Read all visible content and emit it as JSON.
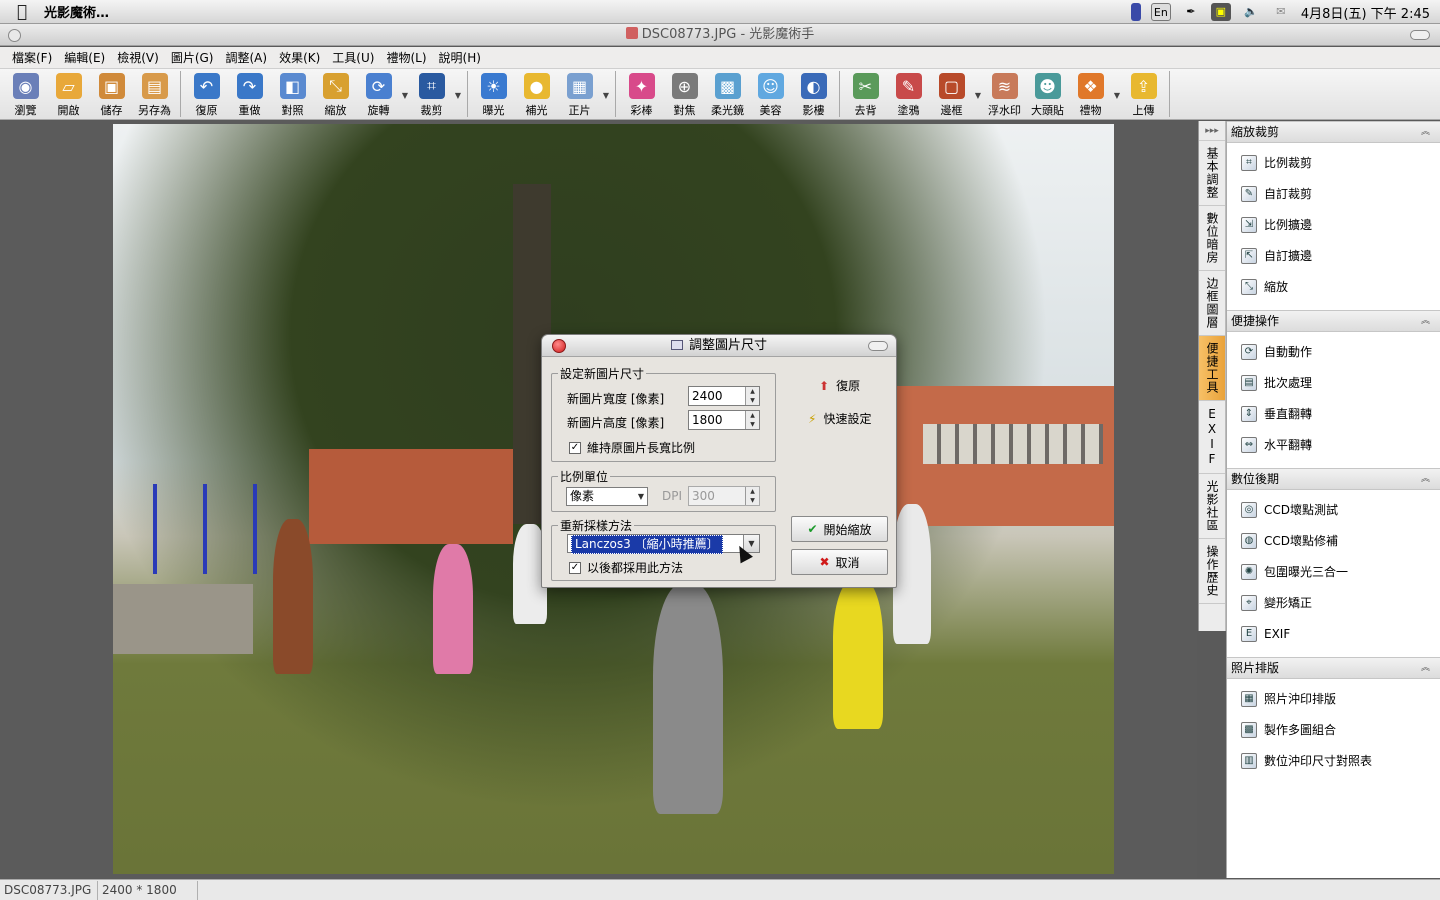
{
  "menubar": {
    "app_name": "光影魔術…",
    "input_lang": "En",
    "clock": "4月8日(五) 下午 2:45"
  },
  "window": {
    "title": "DSC08773.JPG - 光影魔術手"
  },
  "app_menu": [
    "檔案(F)",
    "編輯(E)",
    "檢視(V)",
    "圖片(G)",
    "調整(A)",
    "效果(K)",
    "工具(U)",
    "禮物(L)",
    "說明(H)"
  ],
  "toolbar": {
    "groups": [
      [
        {
          "label": "瀏覽",
          "icon": "eye-icon",
          "color": "#6a7fb8"
        },
        {
          "label": "開啟",
          "icon": "folder-open-icon",
          "color": "#e8a83a"
        },
        {
          "label": "儲存",
          "icon": "save-icon",
          "color": "#d08a3a"
        },
        {
          "label": "另存為",
          "icon": "save-as-icon",
          "color": "#d89a4a"
        }
      ],
      [
        {
          "label": "復原",
          "icon": "undo-icon",
          "color": "#3a78c8"
        },
        {
          "label": "重做",
          "icon": "redo-icon",
          "color": "#3a78c8"
        },
        {
          "label": "對照",
          "icon": "compare-icon",
          "color": "#5a8ad0"
        },
        {
          "label": "縮放",
          "icon": "resize-icon",
          "color": "#d8a030"
        },
        {
          "label": "旋轉",
          "icon": "rotate-icon",
          "color": "#4a80d0",
          "dropdown": true
        },
        {
          "label": "裁剪",
          "icon": "crop-icon",
          "color": "#2a5aa0",
          "dropdown": true
        }
      ],
      [
        {
          "label": "曝光",
          "icon": "sun-icon",
          "color": "#3a7ad0"
        },
        {
          "label": "補光",
          "icon": "bulb-icon",
          "color": "#e8b830"
        },
        {
          "label": "正片",
          "icon": "picture-icon",
          "color": "#7aa0d0",
          "dropdown": true
        }
      ],
      [
        {
          "label": "彩棒",
          "icon": "color-wand-icon",
          "color": "#d84a8a"
        },
        {
          "label": "對焦",
          "icon": "focus-icon",
          "color": "#7a7a7a"
        },
        {
          "label": "柔光鏡",
          "icon": "soft-light-icon",
          "color": "#5aa0d0"
        },
        {
          "label": "美容",
          "icon": "face-icon",
          "color": "#60a8e0"
        },
        {
          "label": "影樓",
          "icon": "studio-icon",
          "color": "#3a6ab8"
        }
      ],
      [
        {
          "label": "去背",
          "icon": "remove-bg-icon",
          "color": "#5a9a5a"
        },
        {
          "label": "塗鴉",
          "icon": "pen-icon",
          "color": "#c84a4a"
        },
        {
          "label": "邊框",
          "icon": "frame-icon",
          "color": "#b84a2a",
          "dropdown": true
        },
        {
          "label": "浮水印",
          "icon": "watermark-icon",
          "color": "#c87a5a"
        },
        {
          "label": "大頭貼",
          "icon": "sticker-icon",
          "color": "#4a9a9a"
        },
        {
          "label": "禮物",
          "icon": "gift-icon",
          "color": "#e0782a",
          "dropdown": true
        },
        {
          "label": "上傳",
          "icon": "upload-icon",
          "color": "#e8b830"
        }
      ]
    ]
  },
  "side_tabs": [
    {
      "label": "基本調整",
      "active": false
    },
    {
      "label": "數位暗房",
      "active": false
    },
    {
      "label": "边框圖層",
      "active": false
    },
    {
      "label": "便捷工具",
      "active": true
    },
    {
      "label": "EXIF",
      "active": false
    },
    {
      "label": "光影社區",
      "active": false
    },
    {
      "label": "操作歷史",
      "active": false
    }
  ],
  "right_panel": {
    "sections": [
      {
        "title": "縮放裁剪",
        "items": [
          {
            "label": "比例裁剪",
            "icon": "ratio-crop-icon"
          },
          {
            "label": "自訂裁剪",
            "icon": "custom-crop-icon"
          },
          {
            "label": "比例擴邊",
            "icon": "ratio-expand-icon"
          },
          {
            "label": "自訂擴邊",
            "icon": "custom-expand-icon"
          },
          {
            "label": "縮放",
            "icon": "scale-icon"
          }
        ]
      },
      {
        "title": "便捷操作",
        "items": [
          {
            "label": "自動動作",
            "icon": "auto-action-icon"
          },
          {
            "label": "批次處理",
            "icon": "batch-icon"
          },
          {
            "label": "垂直翻轉",
            "icon": "flip-vertical-icon"
          },
          {
            "label": "水平翻轉",
            "icon": "flip-horizontal-icon"
          }
        ]
      },
      {
        "title": "數位後期",
        "items": [
          {
            "label": "CCD壞點測試",
            "icon": "ccd-test-icon"
          },
          {
            "label": "CCD壞點修補",
            "icon": "ccd-repair-icon"
          },
          {
            "label": "包圍曝光三合一",
            "icon": "hdr-icon"
          },
          {
            "label": "變形矯正",
            "icon": "distortion-icon"
          },
          {
            "label": "EXIF",
            "icon": "exif-icon"
          }
        ]
      },
      {
        "title": "照片排版",
        "items": [
          {
            "label": "照片沖印排版",
            "icon": "print-layout-icon"
          },
          {
            "label": "製作多圖組合",
            "icon": "collage-icon"
          },
          {
            "label": "數位沖印尺寸對照表",
            "icon": "size-table-icon"
          }
        ]
      }
    ]
  },
  "status": {
    "filename": "DSC08773.JPG",
    "dimensions": "2400 * 1800"
  },
  "dialog": {
    "title": "調整圖片尺寸",
    "group_size": {
      "label": "設定新圖片尺寸",
      "width_label": "新圖片寬度 [像素]",
      "width_value": "2400",
      "height_label": "新圖片高度 [像素]",
      "height_value": "1800",
      "keep_ratio_label": "維持原圖片長寬比例",
      "keep_ratio_checked": true
    },
    "group_unit": {
      "label": "比例單位",
      "unit_value": "像素",
      "dpi_label": "DPI",
      "dpi_value": "300"
    },
    "group_resample": {
      "label": "重新採樣方法",
      "method_value": "Lanczos3 〔縮小時推薦〕",
      "always_label": "以後都採用此方法",
      "always_checked": true
    },
    "restore_label": "復原",
    "quick_label": "快速設定",
    "start_label": "開始縮放",
    "cancel_label": "取消"
  }
}
